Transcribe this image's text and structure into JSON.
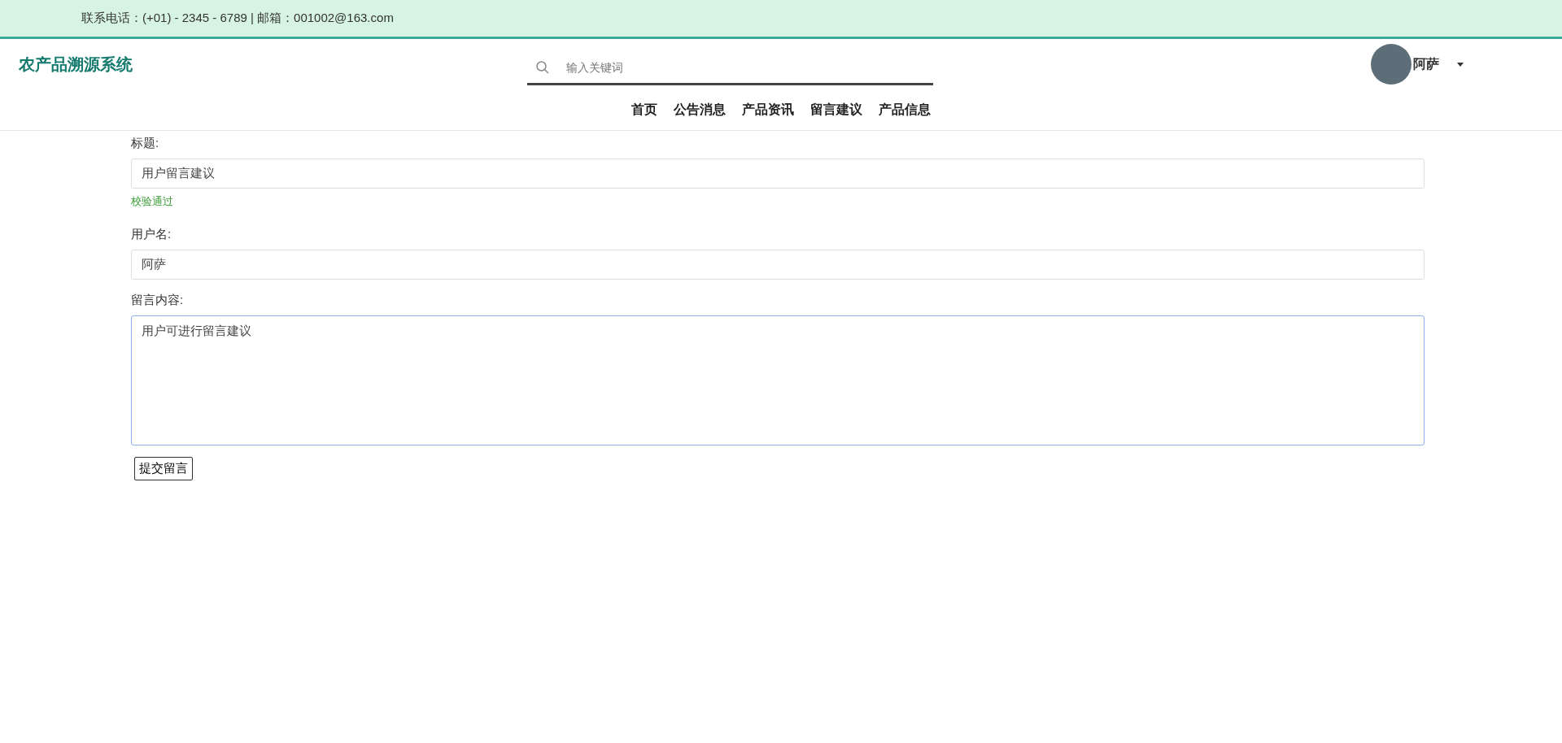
{
  "top_bar": {
    "contact": "联系电话：(+01) - 2345 - 6789 | 邮箱：001002@163.com"
  },
  "header": {
    "logo": "农产品溯源系统",
    "search": {
      "placeholder": "输入关键词"
    },
    "user": {
      "name": "阿萨"
    }
  },
  "nav": [
    "首页",
    "公告消息",
    "产品资讯",
    "留言建议",
    "产品信息"
  ],
  "form": {
    "fields": [
      {
        "kind": "input",
        "label": "标题:",
        "value": "用户留言建议",
        "validation": "校验通过",
        "focused": false
      },
      {
        "kind": "input",
        "label": "用户名:",
        "value": "阿萨",
        "focused": false
      },
      {
        "kind": "textarea",
        "label": "留言内容:",
        "value": "用户可进行留言建议",
        "focused": true
      }
    ],
    "submit": "提交留言"
  }
}
